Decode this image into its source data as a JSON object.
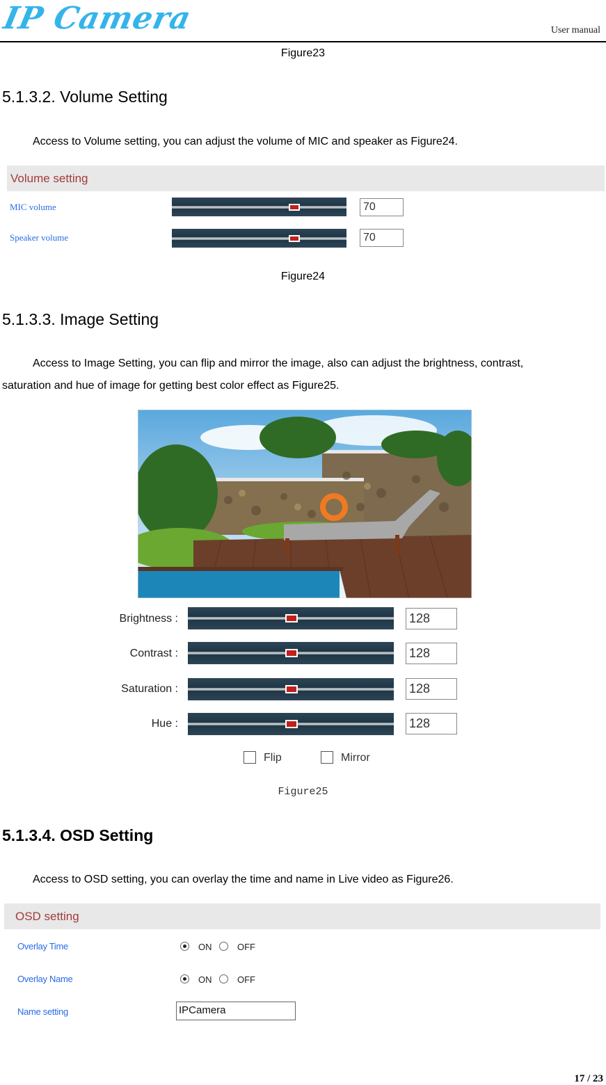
{
  "header": {
    "logo_text": "IP Camera",
    "right_label": "User manual"
  },
  "figure23_caption": "Figure23",
  "sections": {
    "volume": {
      "heading": "5.1.3.2. Volume Setting",
      "paragraph": "Access to Volume setting, you can adjust the volume of MIC and speaker as Figure24.",
      "panel_title": "Volume setting",
      "rows": [
        {
          "label": "MIC volume",
          "value": "70",
          "level_percent": 70
        },
        {
          "label": "Speaker volume",
          "value": "70",
          "level_percent": 70
        }
      ],
      "caption": "Figure24"
    },
    "image": {
      "heading": "5.1.3.3. Image Setting",
      "paragraph_line1": "Access to Image Setting, you can flip and mirror the image, also can adjust the brightness, contrast,",
      "paragraph_line2": "saturation and hue of image for getting best color effect as Figure25.",
      "rows": [
        {
          "label": "Brightness :",
          "value": "128",
          "level": 128,
          "max": 255
        },
        {
          "label": "Contrast :",
          "value": "128",
          "level": 128,
          "max": 255
        },
        {
          "label": "Saturation :",
          "value": "128",
          "level": 128,
          "max": 255
        },
        {
          "label": "Hue :",
          "value": "128",
          "level": 128,
          "max": 255
        }
      ],
      "flip_label": "Flip",
      "flip_checked": false,
      "mirror_label": "Mirror",
      "mirror_checked": false,
      "caption": "Figure25"
    },
    "osd": {
      "heading": "5.1.3.4. OSD Setting",
      "paragraph": "Access to OSD setting, you can overlay the time and name in Live video as Figure26.",
      "panel_title": "OSD setting",
      "overlay_time_label": "Overlay Time",
      "overlay_time_value": "ON",
      "overlay_name_label": "Overlay Name",
      "overlay_name_value": "ON",
      "on_label": "ON",
      "off_label": "OFF",
      "name_setting_label": "Name setting",
      "name_setting_value": "IPCamera"
    }
  },
  "page_number": "17 / 23",
  "colors": {
    "logo": "#34b4ea",
    "panel_title": "#a33b3b",
    "field_label": "#2a6be6",
    "slider_track": "#1e3444",
    "slider_thumb": "#c0211c"
  }
}
